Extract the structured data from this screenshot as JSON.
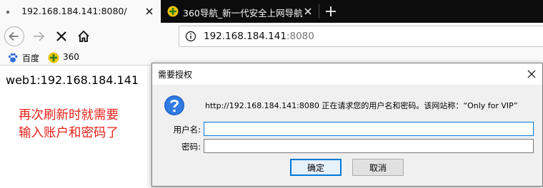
{
  "tabs": [
    {
      "title": "192.168.184.141:8080/",
      "active": true
    },
    {
      "title": "360导航_新一代安全上网导航",
      "active": false
    }
  ],
  "navbar": {
    "url_host": "192.168.184.141",
    "url_port": ":8080"
  },
  "bookmarks": [
    {
      "label": "百度",
      "icon": "paw-icon"
    },
    {
      "label": "360",
      "icon": "360-icon"
    }
  ],
  "page": {
    "text": "web1:192.168.184.141",
    "annotation_line1": "再次刷新时就需要",
    "annotation_line2": "输入账户和密码了"
  },
  "dialog": {
    "title": "需要授权",
    "message": "http://192.168.184.141:8080 正在请求您的用户名和密码。该网站称：“Only for VIP”",
    "username_label": "用户名:",
    "password_label": "密码:",
    "username_value": "",
    "password_value": "",
    "ok_label": "确定",
    "cancel_label": "取消"
  },
  "colors": {
    "tabbar": "#0c0c0d",
    "annotation": "#e8231b",
    "focus": "#0078d7"
  }
}
